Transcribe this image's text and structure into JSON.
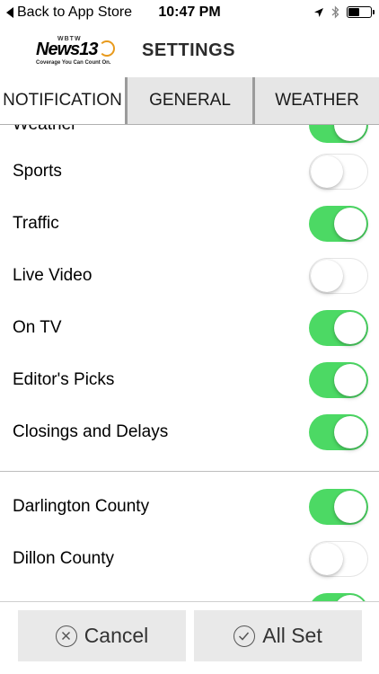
{
  "status_bar": {
    "back_label": "Back to App Store",
    "time": "10:47 PM"
  },
  "header": {
    "logo_small": "WBTW",
    "logo_name": "News",
    "logo_number": "13",
    "logo_tagline": "Coverage You Can Count On.",
    "title": "SETTINGS"
  },
  "tabs": [
    {
      "label": "NOTIFICATION",
      "active": true
    },
    {
      "label": "GENERAL",
      "active": false
    },
    {
      "label": "WEATHER",
      "active": false
    }
  ],
  "rows": [
    {
      "label": "Weather",
      "on": true
    },
    {
      "label": "Sports",
      "on": false
    },
    {
      "label": "Traffic",
      "on": true
    },
    {
      "label": "Live Video",
      "on": false
    },
    {
      "label": "On TV",
      "on": true
    },
    {
      "label": "Editor's Picks",
      "on": true
    },
    {
      "label": "Closings and Delays",
      "on": true
    },
    {
      "label": "Darlington County",
      "on": true
    },
    {
      "label": "Dillon County",
      "on": false
    },
    {
      "label": "",
      "on": true
    }
  ],
  "footer": {
    "cancel_label": "Cancel",
    "allset_label": "All Set"
  },
  "colors": {
    "toggle_on": "#4cd964",
    "logo_accent": "#e89a1c"
  }
}
